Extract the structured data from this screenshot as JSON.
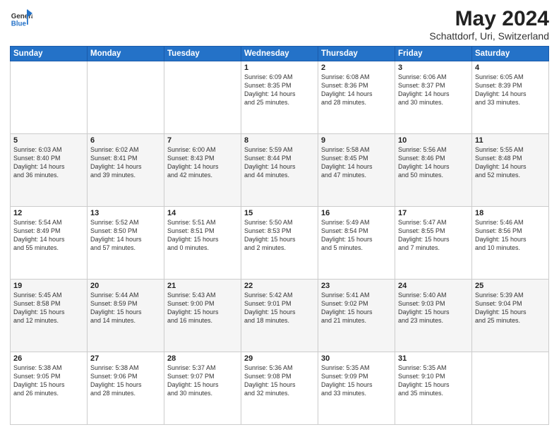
{
  "logo": {
    "general": "General",
    "blue": "Blue"
  },
  "header": {
    "month_year": "May 2024",
    "location": "Schattdorf, Uri, Switzerland"
  },
  "days_of_week": [
    "Sunday",
    "Monday",
    "Tuesday",
    "Wednesday",
    "Thursday",
    "Friday",
    "Saturday"
  ],
  "weeks": [
    {
      "id": 1,
      "days": [
        {
          "num": "",
          "info": ""
        },
        {
          "num": "",
          "info": ""
        },
        {
          "num": "",
          "info": ""
        },
        {
          "num": "1",
          "info": "Sunrise: 6:09 AM\nSunset: 8:35 PM\nDaylight: 14 hours\nand 25 minutes."
        },
        {
          "num": "2",
          "info": "Sunrise: 6:08 AM\nSunset: 8:36 PM\nDaylight: 14 hours\nand 28 minutes."
        },
        {
          "num": "3",
          "info": "Sunrise: 6:06 AM\nSunset: 8:37 PM\nDaylight: 14 hours\nand 30 minutes."
        },
        {
          "num": "4",
          "info": "Sunrise: 6:05 AM\nSunset: 8:39 PM\nDaylight: 14 hours\nand 33 minutes."
        }
      ]
    },
    {
      "id": 2,
      "days": [
        {
          "num": "5",
          "info": "Sunrise: 6:03 AM\nSunset: 8:40 PM\nDaylight: 14 hours\nand 36 minutes."
        },
        {
          "num": "6",
          "info": "Sunrise: 6:02 AM\nSunset: 8:41 PM\nDaylight: 14 hours\nand 39 minutes."
        },
        {
          "num": "7",
          "info": "Sunrise: 6:00 AM\nSunset: 8:43 PM\nDaylight: 14 hours\nand 42 minutes."
        },
        {
          "num": "8",
          "info": "Sunrise: 5:59 AM\nSunset: 8:44 PM\nDaylight: 14 hours\nand 44 minutes."
        },
        {
          "num": "9",
          "info": "Sunrise: 5:58 AM\nSunset: 8:45 PM\nDaylight: 14 hours\nand 47 minutes."
        },
        {
          "num": "10",
          "info": "Sunrise: 5:56 AM\nSunset: 8:46 PM\nDaylight: 14 hours\nand 50 minutes."
        },
        {
          "num": "11",
          "info": "Sunrise: 5:55 AM\nSunset: 8:48 PM\nDaylight: 14 hours\nand 52 minutes."
        }
      ]
    },
    {
      "id": 3,
      "days": [
        {
          "num": "12",
          "info": "Sunrise: 5:54 AM\nSunset: 8:49 PM\nDaylight: 14 hours\nand 55 minutes."
        },
        {
          "num": "13",
          "info": "Sunrise: 5:52 AM\nSunset: 8:50 PM\nDaylight: 14 hours\nand 57 minutes."
        },
        {
          "num": "14",
          "info": "Sunrise: 5:51 AM\nSunset: 8:51 PM\nDaylight: 15 hours\nand 0 minutes."
        },
        {
          "num": "15",
          "info": "Sunrise: 5:50 AM\nSunset: 8:53 PM\nDaylight: 15 hours\nand 2 minutes."
        },
        {
          "num": "16",
          "info": "Sunrise: 5:49 AM\nSunset: 8:54 PM\nDaylight: 15 hours\nand 5 minutes."
        },
        {
          "num": "17",
          "info": "Sunrise: 5:47 AM\nSunset: 8:55 PM\nDaylight: 15 hours\nand 7 minutes."
        },
        {
          "num": "18",
          "info": "Sunrise: 5:46 AM\nSunset: 8:56 PM\nDaylight: 15 hours\nand 10 minutes."
        }
      ]
    },
    {
      "id": 4,
      "days": [
        {
          "num": "19",
          "info": "Sunrise: 5:45 AM\nSunset: 8:58 PM\nDaylight: 15 hours\nand 12 minutes."
        },
        {
          "num": "20",
          "info": "Sunrise: 5:44 AM\nSunset: 8:59 PM\nDaylight: 15 hours\nand 14 minutes."
        },
        {
          "num": "21",
          "info": "Sunrise: 5:43 AM\nSunset: 9:00 PM\nDaylight: 15 hours\nand 16 minutes."
        },
        {
          "num": "22",
          "info": "Sunrise: 5:42 AM\nSunset: 9:01 PM\nDaylight: 15 hours\nand 18 minutes."
        },
        {
          "num": "23",
          "info": "Sunrise: 5:41 AM\nSunset: 9:02 PM\nDaylight: 15 hours\nand 21 minutes."
        },
        {
          "num": "24",
          "info": "Sunrise: 5:40 AM\nSunset: 9:03 PM\nDaylight: 15 hours\nand 23 minutes."
        },
        {
          "num": "25",
          "info": "Sunrise: 5:39 AM\nSunset: 9:04 PM\nDaylight: 15 hours\nand 25 minutes."
        }
      ]
    },
    {
      "id": 5,
      "days": [
        {
          "num": "26",
          "info": "Sunrise: 5:38 AM\nSunset: 9:05 PM\nDaylight: 15 hours\nand 26 minutes."
        },
        {
          "num": "27",
          "info": "Sunrise: 5:38 AM\nSunset: 9:06 PM\nDaylight: 15 hours\nand 28 minutes."
        },
        {
          "num": "28",
          "info": "Sunrise: 5:37 AM\nSunset: 9:07 PM\nDaylight: 15 hours\nand 30 minutes."
        },
        {
          "num": "29",
          "info": "Sunrise: 5:36 AM\nSunset: 9:08 PM\nDaylight: 15 hours\nand 32 minutes."
        },
        {
          "num": "30",
          "info": "Sunrise: 5:35 AM\nSunset: 9:09 PM\nDaylight: 15 hours\nand 33 minutes."
        },
        {
          "num": "31",
          "info": "Sunrise: 5:35 AM\nSunset: 9:10 PM\nDaylight: 15 hours\nand 35 minutes."
        },
        {
          "num": "",
          "info": ""
        }
      ]
    }
  ]
}
